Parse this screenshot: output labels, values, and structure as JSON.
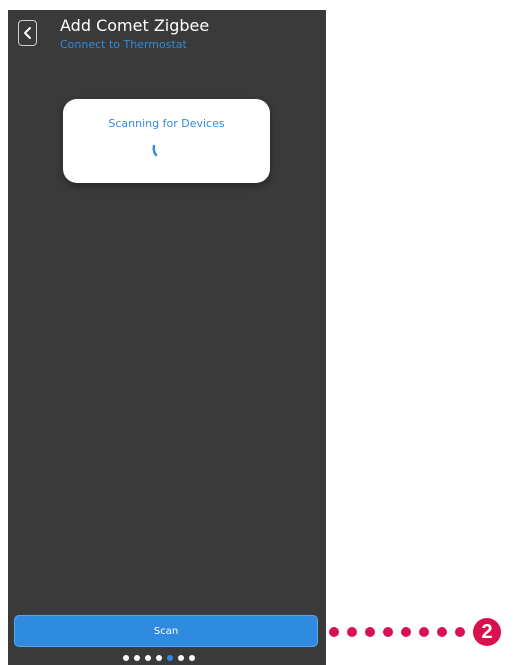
{
  "header": {
    "title": "Add Comet Zigbee",
    "subtitle": "Connect to Thermostat",
    "back_icon": "chevron-left-icon"
  },
  "dialog": {
    "label": "Scanning for Devices",
    "spinner_icon": "loading-spinner-icon"
  },
  "footer": {
    "scan_label": "Scan",
    "pager": {
      "total": 7,
      "active_index": 4
    }
  },
  "annotation": {
    "badge_number": "2"
  },
  "colors": {
    "background": "#3a3a3a",
    "accent": "#2f8be0",
    "callout": "#d8124f"
  }
}
